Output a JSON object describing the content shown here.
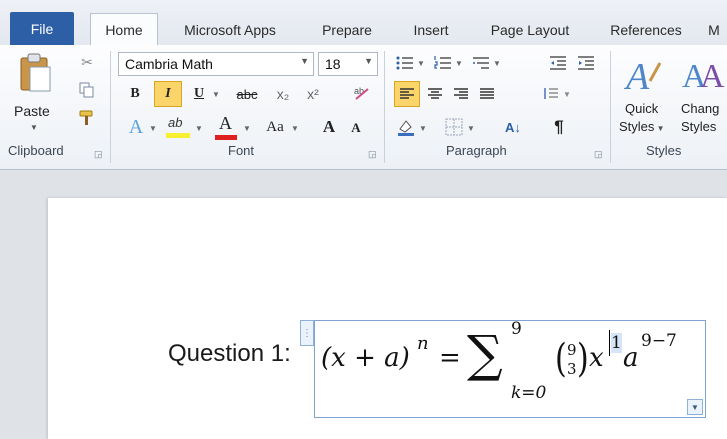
{
  "tabs": [
    "File",
    "Home",
    "Microsoft Apps",
    "Prepare",
    "Insert",
    "Page Layout",
    "References",
    "M"
  ],
  "clipboard": {
    "paste": "Paste",
    "group": "Clipboard"
  },
  "font": {
    "name": "Cambria Math",
    "size": "18",
    "group": "Font",
    "bold": "B",
    "italic": "I",
    "underline": "U",
    "strike": "abc",
    "sub": "x₂",
    "sup": "x²",
    "highlight": "ab",
    "fontcolor": "A",
    "case": "Aa",
    "grow": "A",
    "shrink": "A"
  },
  "paragraph": {
    "group": "Paragraph",
    "para_mark": "¶",
    "sort": "A↓"
  },
  "styles": {
    "quick": "Quick",
    "quick2": "Styles",
    "change": "Chang",
    "change2": "Styles",
    "group": "Styles"
  },
  "document": {
    "question_label": "Question 1:",
    "equation": {
      "lhs": "(x + a)",
      "lhs_exp": "n",
      "eq": "=",
      "sum": "∑",
      "upper": "9",
      "lower": "k=0",
      "binom_top": "9",
      "binom_bot": "3",
      "x": "x",
      "x_exp": "1",
      "a": "a",
      "a_exp": "9−7"
    }
  }
}
